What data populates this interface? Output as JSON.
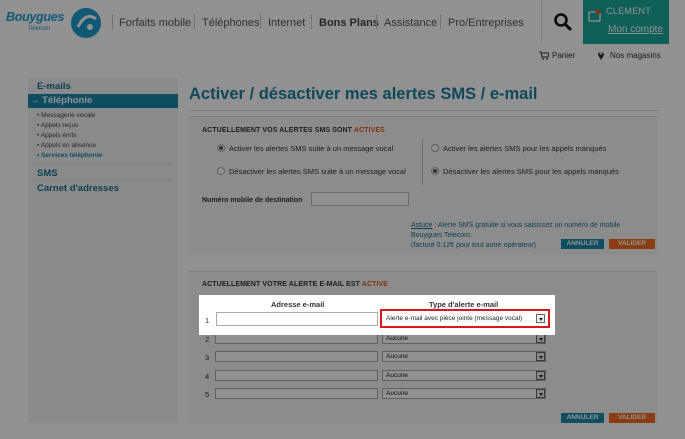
{
  "header": {
    "logo_name": "Bouygues",
    "logo_sub": "Telecom",
    "nav": [
      "Forfaits mobile",
      "Téléphones",
      "Internet",
      "Bons Plans",
      "Assistance",
      "Pro/Entreprises"
    ],
    "user_name": "CLEMENT",
    "account_link": "Mon compte",
    "cart_label": "Panier",
    "stores_label": "Nos magasins"
  },
  "sidebar": {
    "emails": "E-mails",
    "telephonie": "Téléphonie",
    "sub_items": [
      "Messagerie vocale",
      "Appels reçus",
      "Appels émis",
      "Appels en absence",
      "Services téléphonie"
    ],
    "sms": "SMS",
    "carnet": "Carnet d'adresses"
  },
  "main": {
    "title": "Activer / désactiver mes alertes SMS / e-mail",
    "sms_panel": {
      "heading": "ACTUELLEMENT VOS ALERTES SMS SONT",
      "status": "ACTIVES",
      "radios": [
        "Activer les alertes SMS suite à un message vocal",
        "Désactiver les alertes SMS suite à un message vocal",
        "Activer les alertes SMS pour les appels manqués",
        "Désactiver les alertes SMS pour les appels manqués"
      ],
      "dest_label": "Numéro mobile de destination",
      "tip_link": "Astuce",
      "tip_text": " : Alerte SMS gratuite si vous saisissez un numéro de mobile Bouygues Telecom.",
      "tip_text2": "(facturé 0.12€ pour tout autre opérateur)",
      "cancel": "ANNULER",
      "validate": "VALIDER"
    },
    "email_panel": {
      "heading": "ACTUELLEMENT VOTRE ALERTE E-MAIL EST",
      "status": "ACTIVE",
      "col_email": "Adresse e-mail",
      "col_type": "Type d'alerte e-mail",
      "rows": [
        {
          "num": "1",
          "type": "Alerte e-mail avec pièce jointe (message vocal)"
        },
        {
          "num": "2",
          "type": "Aucune"
        },
        {
          "num": "3",
          "type": "Aucune"
        },
        {
          "num": "4",
          "type": "Aucune"
        },
        {
          "num": "5",
          "type": "Aucune"
        }
      ],
      "cancel": "ANNULER",
      "validate": "VALIDER"
    }
  }
}
